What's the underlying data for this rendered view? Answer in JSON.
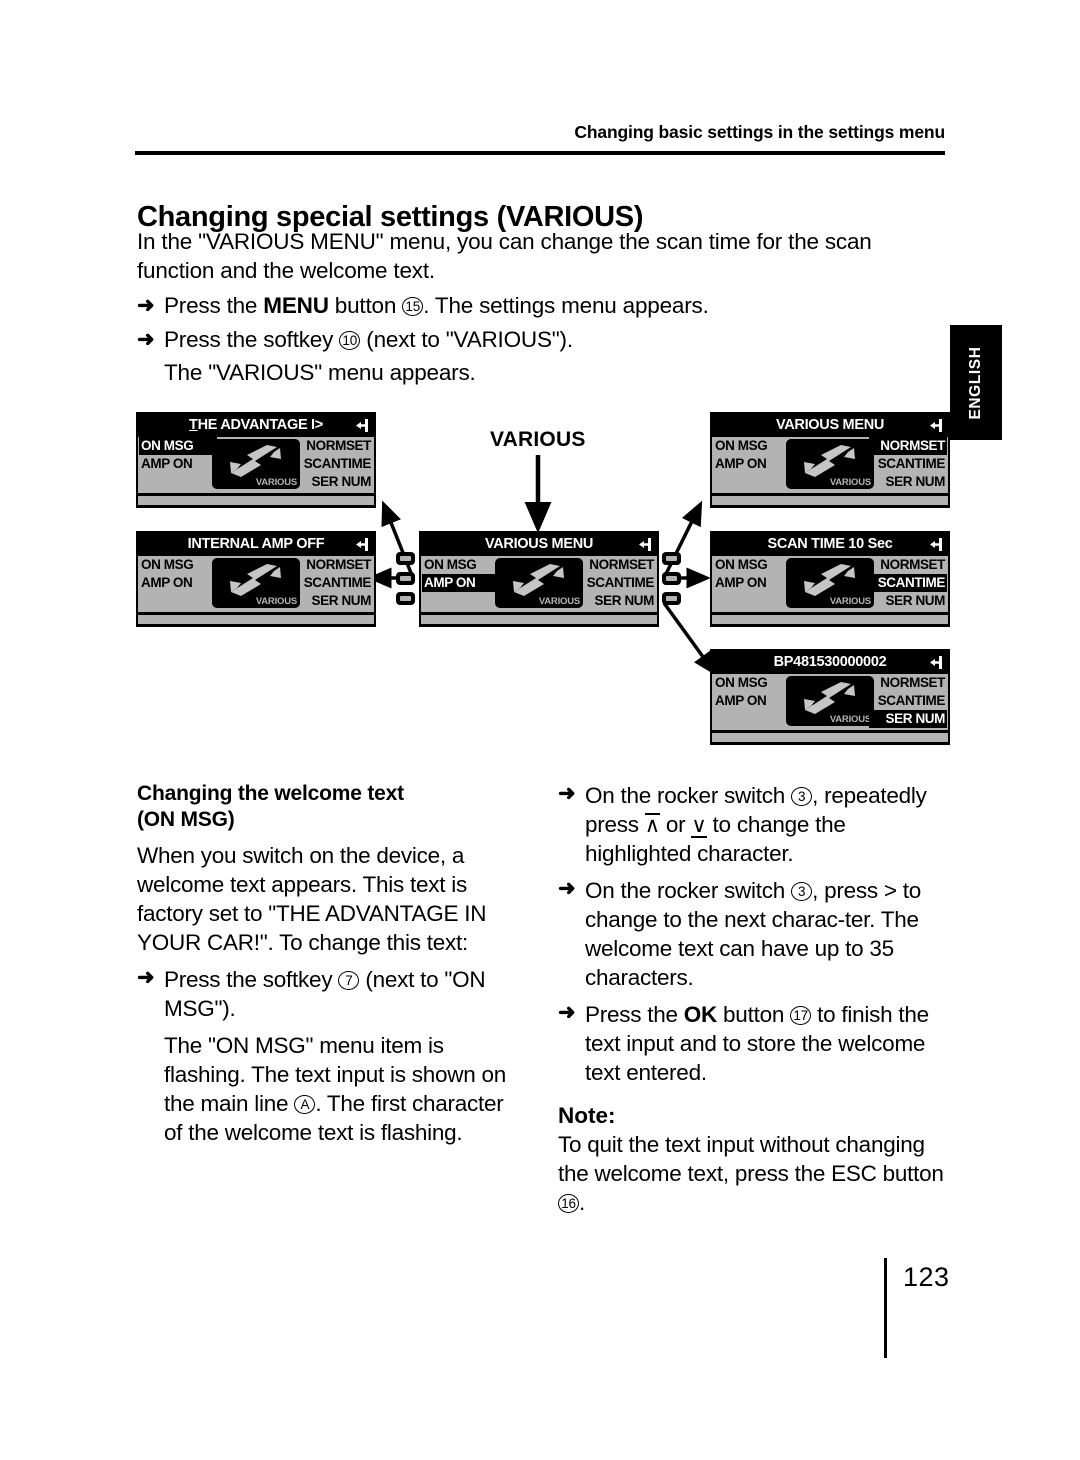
{
  "page": {
    "running_head": "Changing basic settings in the settings menu",
    "title": "Changing special settings (VARIOUS)",
    "folio": "123",
    "thumb_tab": "ENGLISH"
  },
  "intro": {
    "text": "In the \"VARIOUS MENU\" menu, you can change the scan time for the scan function and the welcome text."
  },
  "steps": {
    "menu_button": {
      "arrow": "➜",
      "pre": "Press the ",
      "bold": "MENU",
      "mid": " button ",
      "ref": "15",
      "post": ". The settings menu appears."
    },
    "softkey_10": {
      "arrow": "➜",
      "pre": "Press the softkey ",
      "ref": "10",
      "post": " (next to \"VARIOUS\")."
    },
    "various_appears": "The \"VARIOUS\" menu appears."
  },
  "diagram": {
    "label": "VARIOUS",
    "logo_label": "VARIOUS",
    "menu_left": [
      "ON MSG",
      "AMP ON",
      ""
    ],
    "menu_right": [
      "NORMSET",
      "SCANTIME",
      "SER NUM"
    ],
    "screens": [
      {
        "id": "screen-the-advantage",
        "title": "THE ADVANTAGE I>",
        "title_underline_first": true,
        "highlight_left": "ON MSG",
        "highlight_right": ""
      },
      {
        "id": "screen-internal-amp-off",
        "title": "INTERNAL AMP OFF",
        "highlight_left": "",
        "highlight_right": ""
      },
      {
        "id": "screen-various-menu-center",
        "title": "VARIOUS MENU",
        "highlight_left": "AMP ON",
        "highlight_right": ""
      },
      {
        "id": "screen-various-menu-top-right",
        "title": "VARIOUS MENU",
        "highlight_left": "",
        "highlight_right": "NORMSET"
      },
      {
        "id": "screen-scan-time",
        "title": "SCAN TIME 10 Sec",
        "highlight_left": "",
        "highlight_right": "SCANTIME"
      },
      {
        "id": "screen-serial-number",
        "title": "BP481530000002",
        "highlight_left": "",
        "highlight_right": "SER NUM"
      }
    ]
  },
  "left_column": {
    "heading_line1": "Changing the welcome text",
    "heading_line2": "(ON MSG)",
    "para1": "When you switch on the device, a welcome text appears. This text is factory set to \"THE ADVANTAGE IN YOUR CAR!\". To change this text:",
    "step_softkey7": {
      "arrow": "➜",
      "pre": "Press the softkey ",
      "ref": "7",
      "post": " (next to \"ON MSG\")."
    },
    "result_pre": "The \"ON MSG\" menu item is flashing. The text input is shown on the main line ",
    "result_ref": "A",
    "result_post": ". The first character of the welcome text is flashing."
  },
  "right_column": {
    "step_rocker_updown": {
      "arrow": "➜",
      "pre": "On the rocker switch ",
      "ref": "3",
      "mid": ", repeatedly press ",
      "up": "∧",
      "or": " or ",
      "down": "∨",
      "post": " to change the highlighted character."
    },
    "step_rocker_next": {
      "arrow": "➜",
      "pre": "On the rocker switch ",
      "ref": "3",
      "post": ", press > to change to the next charac-ter. The welcome text can have up to 35 characters."
    },
    "step_ok": {
      "arrow": "➜",
      "pre": "Press the ",
      "bold": "OK",
      "mid": " button ",
      "ref": "17",
      "post": " to finish the text input and to store the welcome text entered."
    },
    "note_heading": "Note:",
    "note_pre": "To quit the text input without changing the welcome text, press the ESC button ",
    "note_ref": "16",
    "note_post": "."
  },
  "colors": {
    "screen_bg": "#000000",
    "screen_panel": "#b3b3b3",
    "ink": "#000000",
    "paper": "#ffffff"
  }
}
